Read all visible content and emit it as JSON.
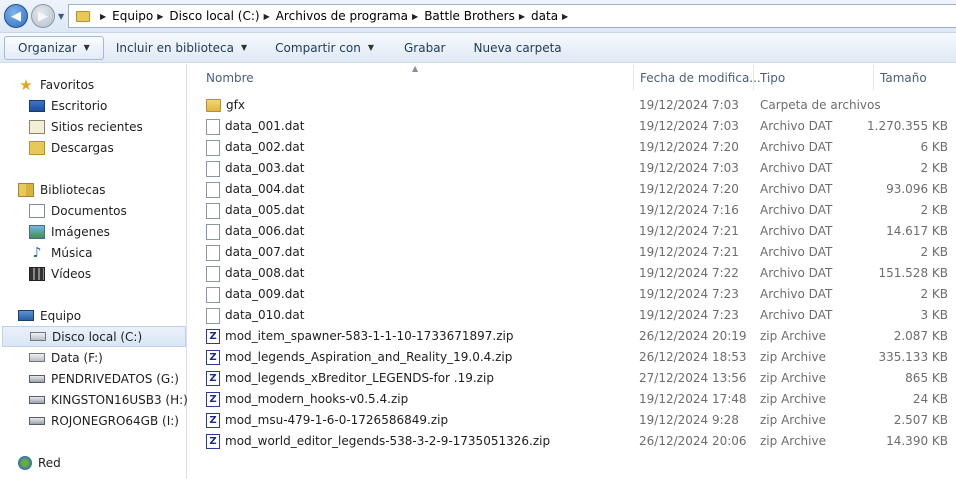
{
  "address": {
    "crumbs": [
      "Equipo",
      "Disco local (C:)",
      "Archivos de programa",
      "Battle Brothers",
      "data"
    ]
  },
  "toolbar": {
    "organize": "Organizar",
    "include_library": "Incluir en biblioteca",
    "share_with": "Compartir con",
    "burn": "Grabar",
    "new_folder": "Nueva carpeta"
  },
  "nav": {
    "favorites": "Favoritos",
    "desktop": "Escritorio",
    "recent": "Sitios recientes",
    "downloads": "Descargas",
    "libraries": "Bibliotecas",
    "documents": "Documentos",
    "images": "Imágenes",
    "music": "Música",
    "videos": "Vídeos",
    "computer": "Equipo",
    "local_disk": "Disco local (C:)",
    "data_drive": "Data (F:)",
    "pendrive": "PENDRIVEDATOS (G:)",
    "kingston": "KINGSTON16USB3 (H:)",
    "rojonegro": "ROJONEGRO64GB (I:)",
    "network": "Red"
  },
  "columns": {
    "name": "Nombre",
    "date": "Fecha de modifica...",
    "type": "Tipo",
    "size": "Tamaño"
  },
  "files": [
    {
      "icon": "folder-icon",
      "name": "gfx",
      "date": "19/12/2024 7:03",
      "type": "Carpeta de archivos",
      "size": ""
    },
    {
      "icon": "file-icon",
      "name": "data_001.dat",
      "date": "19/12/2024 7:03",
      "type": "Archivo DAT",
      "size": "1.270.355 KB"
    },
    {
      "icon": "file-icon",
      "name": "data_002.dat",
      "date": "19/12/2024 7:20",
      "type": "Archivo DAT",
      "size": "6 KB"
    },
    {
      "icon": "file-icon",
      "name": "data_003.dat",
      "date": "19/12/2024 7:03",
      "type": "Archivo DAT",
      "size": "2 KB"
    },
    {
      "icon": "file-icon",
      "name": "data_004.dat",
      "date": "19/12/2024 7:20",
      "type": "Archivo DAT",
      "size": "93.096 KB"
    },
    {
      "icon": "file-icon",
      "name": "data_005.dat",
      "date": "19/12/2024 7:16",
      "type": "Archivo DAT",
      "size": "2 KB"
    },
    {
      "icon": "file-icon",
      "name": "data_006.dat",
      "date": "19/12/2024 7:21",
      "type": "Archivo DAT",
      "size": "14.617 KB"
    },
    {
      "icon": "file-icon",
      "name": "data_007.dat",
      "date": "19/12/2024 7:21",
      "type": "Archivo DAT",
      "size": "2 KB"
    },
    {
      "icon": "file-icon",
      "name": "data_008.dat",
      "date": "19/12/2024 7:22",
      "type": "Archivo DAT",
      "size": "151.528 KB"
    },
    {
      "icon": "file-icon",
      "name": "data_009.dat",
      "date": "19/12/2024 7:23",
      "type": "Archivo DAT",
      "size": "2 KB"
    },
    {
      "icon": "file-icon",
      "name": "data_010.dat",
      "date": "19/12/2024 7:23",
      "type": "Archivo DAT",
      "size": "3 KB"
    },
    {
      "icon": "zip-icon",
      "name": "mod_item_spawner-583-1-1-10-1733671897.zip",
      "date": "26/12/2024 20:19",
      "type": "zip Archive",
      "size": "2.087 KB"
    },
    {
      "icon": "zip-icon",
      "name": "mod_legends_Aspiration_and_Reality_19.0.4.zip",
      "date": "26/12/2024 18:53",
      "type": "zip Archive",
      "size": "335.133 KB"
    },
    {
      "icon": "zip-icon",
      "name": "mod_legends_xBreditor_LEGENDS-for .19.zip",
      "date": "27/12/2024 13:56",
      "type": "zip Archive",
      "size": "865 KB"
    },
    {
      "icon": "zip-icon",
      "name": "mod_modern_hooks-v0.5.4.zip",
      "date": "19/12/2024 17:48",
      "type": "zip Archive",
      "size": "24 KB"
    },
    {
      "icon": "zip-icon",
      "name": "mod_msu-479-1-6-0-1726586849.zip",
      "date": "19/12/2024 9:28",
      "type": "zip Archive",
      "size": "2.507 KB"
    },
    {
      "icon": "zip-icon",
      "name": "mod_world_editor_legends-538-3-2-9-1735051326.zip",
      "date": "26/12/2024 20:06",
      "type": "zip Archive",
      "size": "14.390 KB"
    }
  ],
  "colors": {
    "selection": "#d9e6f4",
    "link_text": "#1e395b",
    "meta_text": "#6d6d6d"
  }
}
